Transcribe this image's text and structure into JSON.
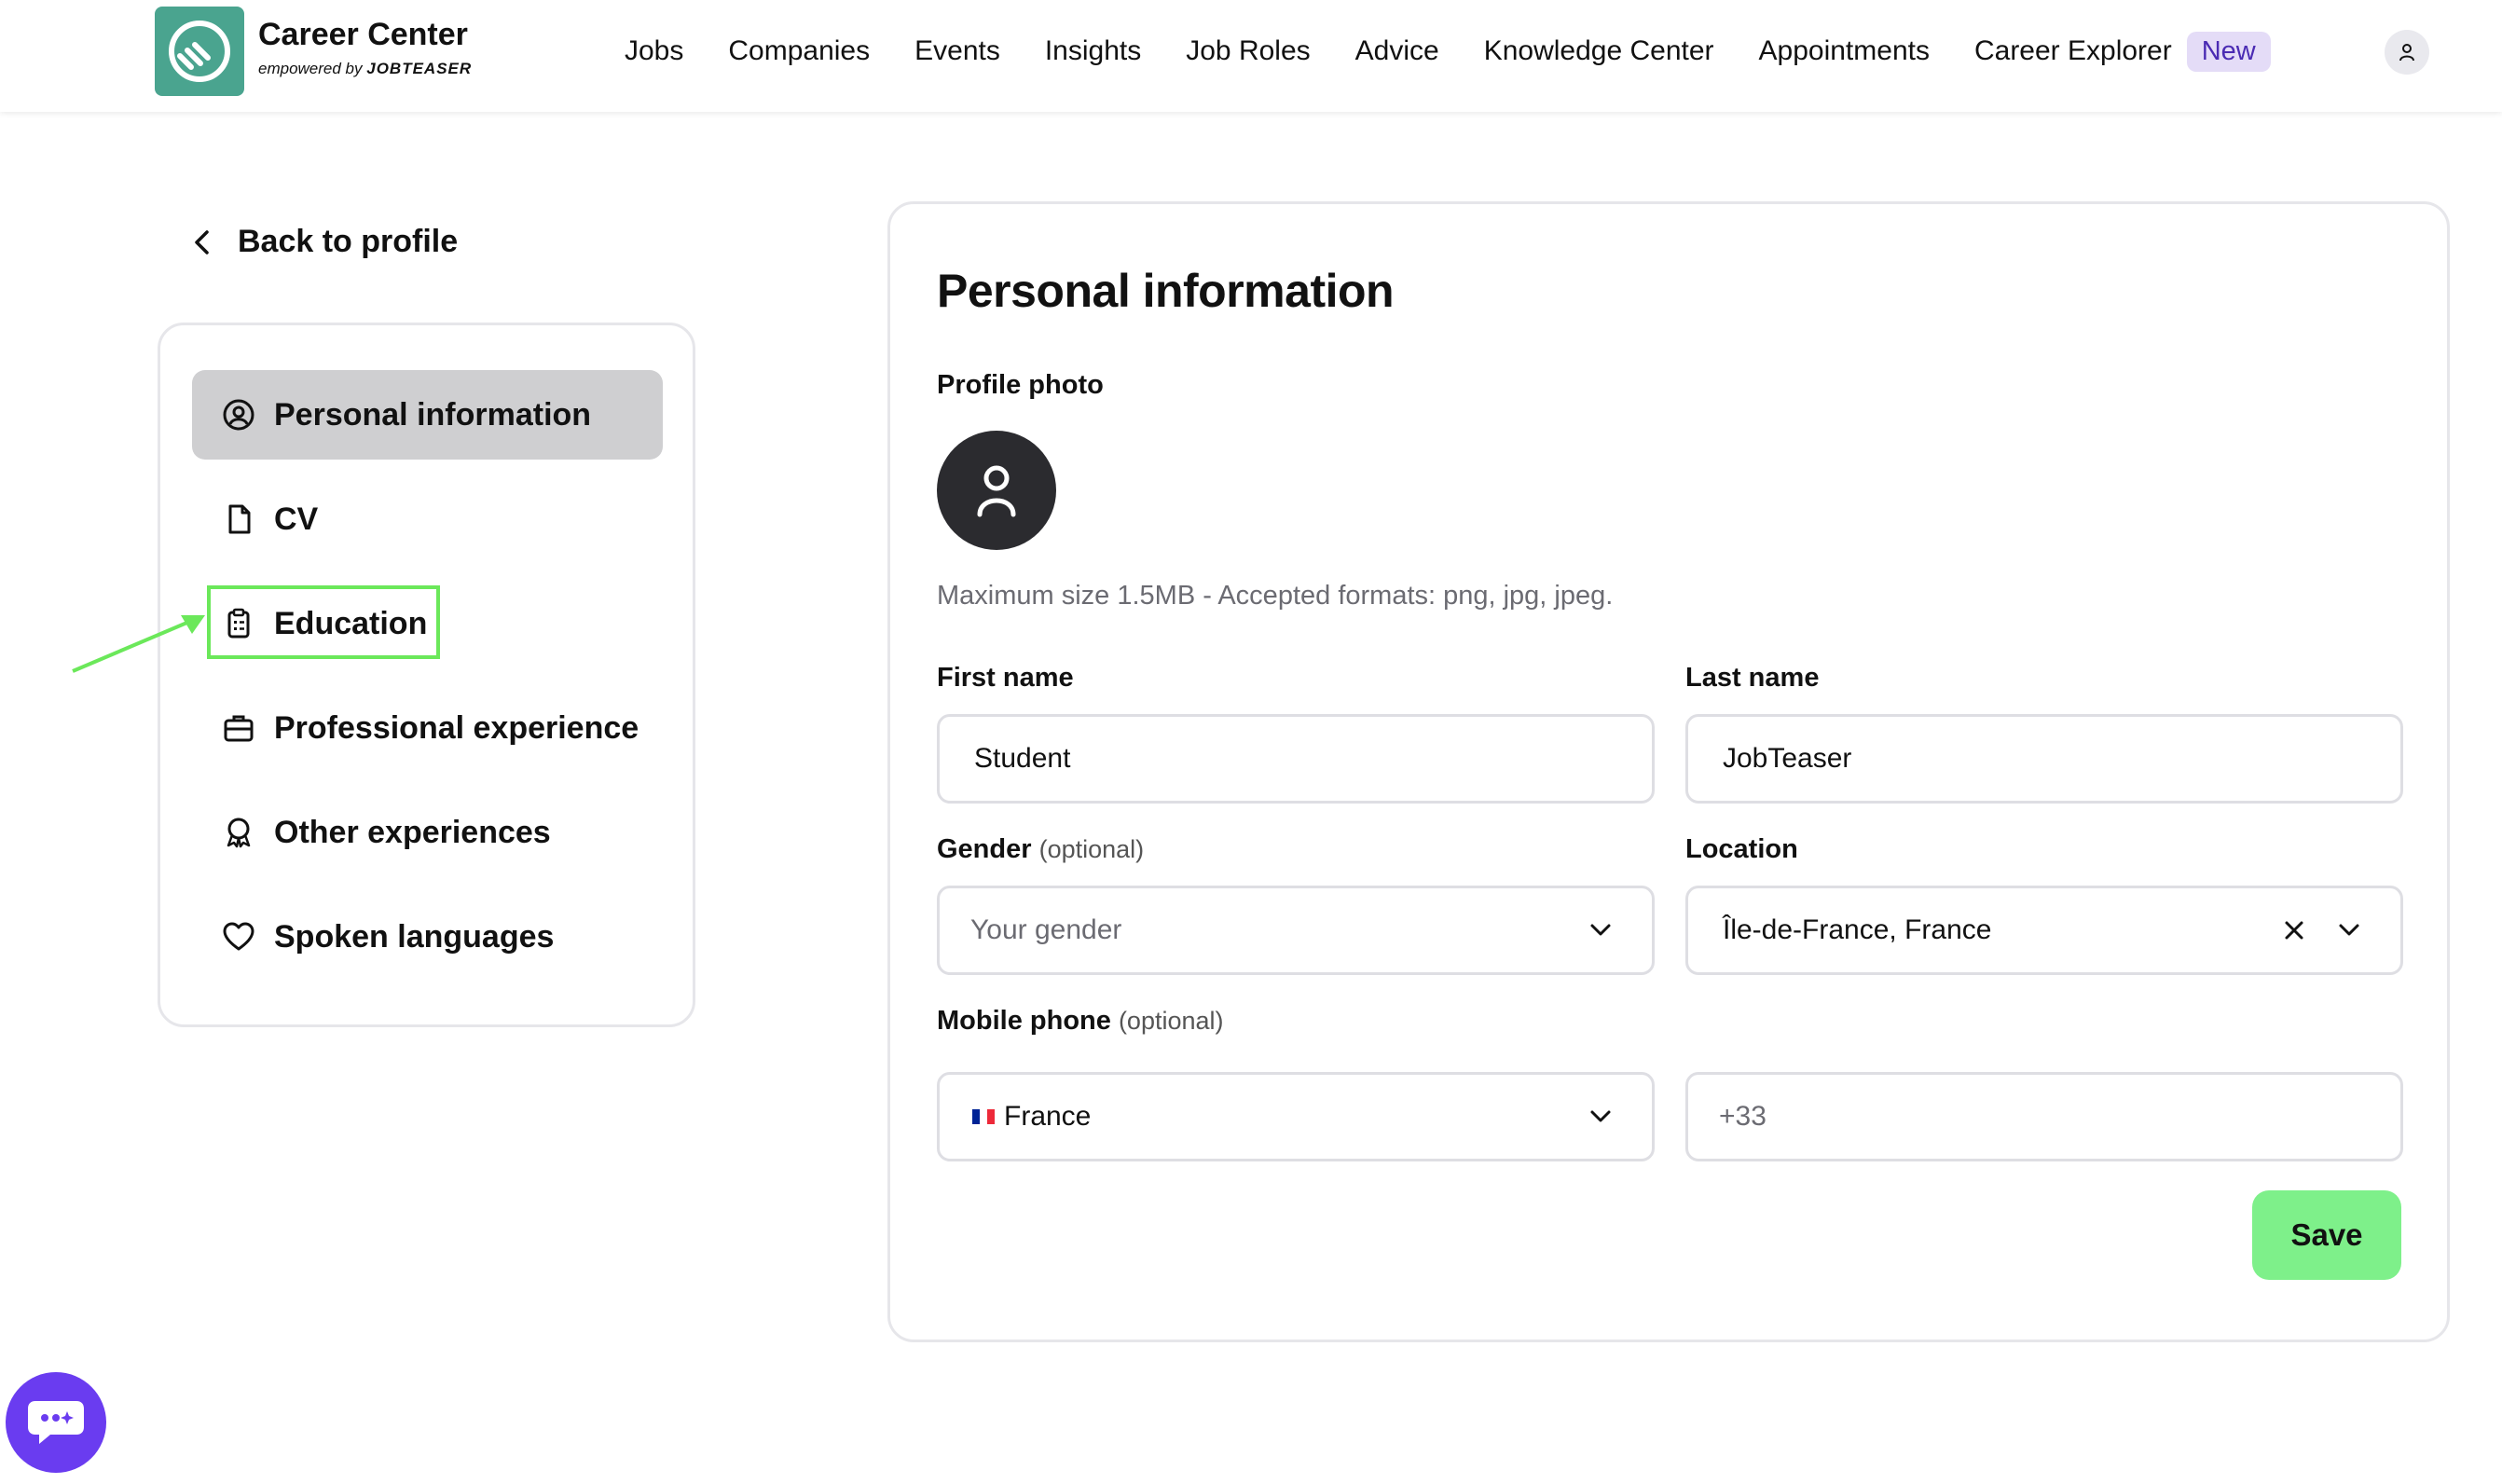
{
  "header": {
    "brand_title": "Career Center",
    "brand_sub_prefix": "empowered by",
    "brand_sub_name": "JOBTEASER",
    "nav": [
      "Jobs",
      "Companies",
      "Events",
      "Insights",
      "Job Roles",
      "Advice",
      "Knowledge Center",
      "Appointments",
      "Career Explorer"
    ],
    "new_badge": "New"
  },
  "back_label": "Back to profile",
  "sidebar": {
    "items": [
      {
        "label": "Personal information",
        "icon": "user-circle-icon",
        "active": true
      },
      {
        "label": "CV",
        "icon": "file-icon"
      },
      {
        "label": "Education",
        "icon": "clipboard-icon"
      },
      {
        "label": "Professional experience",
        "icon": "briefcase-icon"
      },
      {
        "label": "Other experiences",
        "icon": "award-icon"
      },
      {
        "label": "Spoken languages",
        "icon": "heart-icon"
      }
    ]
  },
  "form": {
    "title": "Personal information",
    "photo_label": "Profile photo",
    "photo_hint": "Maximum size 1.5MB - Accepted formats: png, jpg, jpeg.",
    "first_name_label": "First name",
    "first_name_value": "Student",
    "last_name_label": "Last name",
    "last_name_value": "JobTeaser",
    "gender_label": "Gender",
    "optional": "(optional)",
    "gender_placeholder": "Your gender",
    "location_label": "Location",
    "location_value": "Île-de-France, France",
    "phone_label": "Mobile phone",
    "country_value": "France",
    "phone_placeholder": "+33",
    "save_label": "Save"
  },
  "colors": {
    "brand_green": "#4aa48f",
    "save_green": "#7ef08a",
    "highlight_green": "#6be85a",
    "chat_purple": "#6a3cf0",
    "badge_bg": "#e4dcf7"
  }
}
